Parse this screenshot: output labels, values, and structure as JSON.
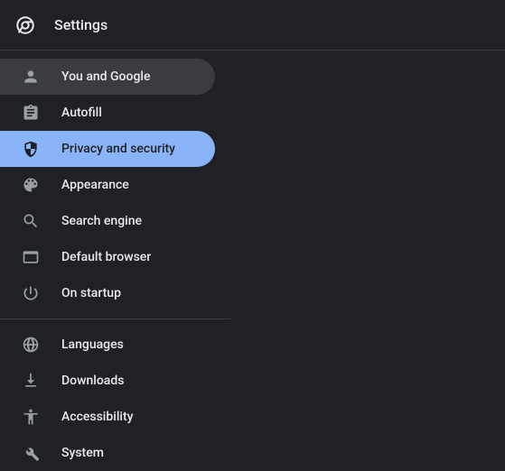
{
  "header": {
    "title": "Settings"
  },
  "sidebar": {
    "items": [
      {
        "label": "You and Google"
      },
      {
        "label": "Autofill"
      },
      {
        "label": "Privacy and security"
      },
      {
        "label": "Appearance"
      },
      {
        "label": "Search engine"
      },
      {
        "label": "Default browser"
      },
      {
        "label": "On startup"
      },
      {
        "label": "Languages"
      },
      {
        "label": "Downloads"
      },
      {
        "label": "Accessibility"
      },
      {
        "label": "System"
      }
    ]
  }
}
